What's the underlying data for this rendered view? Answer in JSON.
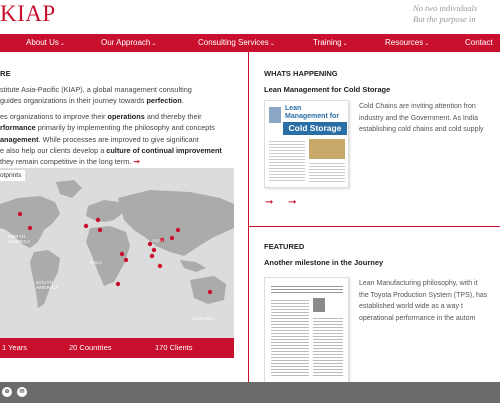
{
  "brand": {
    "logo_text": "KIAP",
    "accent": "#c8102e"
  },
  "tagline": {
    "line1": "No two individuals",
    "line2": "But the purpose in"
  },
  "nav": {
    "items": [
      {
        "label": "About Us"
      },
      {
        "label": "Our Approach"
      },
      {
        "label": "Consulting Services"
      },
      {
        "label": "Training"
      },
      {
        "label": "Resources"
      },
      {
        "label": "Contact"
      }
    ],
    "caret": "⌄"
  },
  "intro": {
    "heading": "RE",
    "l1": "stitute Asia-Pacific (KIAP), a global management consulting",
    "l2a": " guides organizations in their journey towards ",
    "l2b": "perfection",
    "l2c": ".",
    "l3a": "es organizations to improve their ",
    "l3b": "operations",
    "l3c": " and thereby their",
    "l4a": "rformance",
    "l4b": " primarily by implementing the philosophy and concepts",
    "l5a": "anagement",
    "l5b": ". While processes are improved to give significant",
    "l6a": "e also help our clients develop a ",
    "l6b": "culture of continual improvement",
    "l7": " they remain competitive in the long term. ",
    "arrow": "➞"
  },
  "map": {
    "tab_label": "otprints",
    "labels": {
      "north_america": "NORTH\nAMERICA",
      "south_america": "SOUTH\nAMERICA",
      "africa": "RICA",
      "asia": "ASIA",
      "oceania": "OCEANIA"
    }
  },
  "stats": {
    "years": "1 Years",
    "countries": "20 Countries",
    "clients": "170 Clients"
  },
  "whats_happening": {
    "heading": "WHATS HAPPENING",
    "title": "Lean Management for Cold Storage",
    "thumb_line1": "Lean",
    "thumb_line2": "Management for",
    "thumb_line3": "Cold Storage",
    "t1": "Cold Chains are inviting attention fron",
    "t2": "industry and the Government. As India",
    "t3": "establishing cold chains and cold supply",
    "arrows": "➞ ➞"
  },
  "featured": {
    "heading": "FEATURED",
    "title": "Another milestone in the Journey",
    "t1": "Lean Manufacturing philosophy, with it",
    "t2": "the Toyota Production System (TPS), has",
    "t3": "established world wide as a way t",
    "t4": "operational performance in the autom"
  },
  "footer": {
    "icon1": "⊕",
    "icon2": "✉"
  }
}
